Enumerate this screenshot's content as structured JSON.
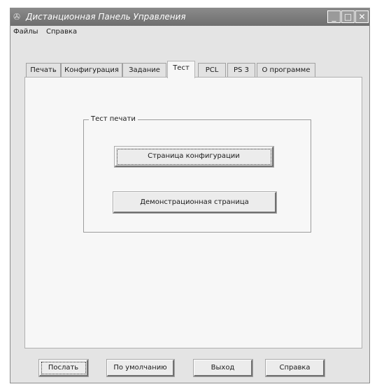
{
  "window": {
    "title": "Дистанционная Панель Управления",
    "icon": "printer-icon",
    "controls": {
      "minimize": "_",
      "maximize": "□",
      "close": "✕"
    }
  },
  "menu": {
    "items": [
      {
        "label": "Файлы"
      },
      {
        "label": "Справка"
      }
    ]
  },
  "tabs": [
    {
      "label": "Печать",
      "active": false
    },
    {
      "label": "Конфигурация",
      "active": false
    },
    {
      "label": "Задание",
      "active": false
    },
    {
      "label": "Тест",
      "active": true
    },
    {
      "label": "PCL",
      "active": false
    },
    {
      "label": "PS 3",
      "active": false
    },
    {
      "label": "О программе",
      "active": false
    }
  ],
  "test_group": {
    "label": "Тест печати",
    "config_page_button": "Страница конфигурации",
    "demo_page_button": "Демонстрационная страница"
  },
  "footer": {
    "send": "Послать",
    "default": "По умолчанию",
    "exit": "Выход",
    "help": "Справка"
  }
}
